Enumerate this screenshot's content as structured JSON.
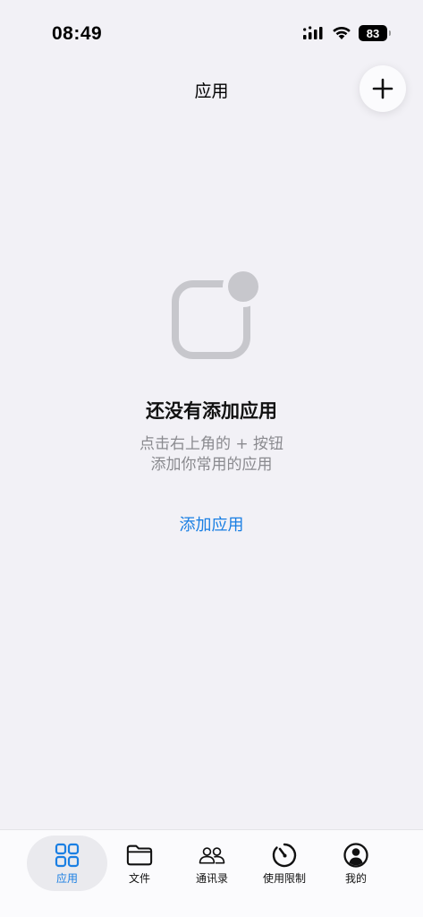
{
  "status_bar": {
    "time": "08:49",
    "battery": "83"
  },
  "header": {
    "title": "应用",
    "add_button_icon": "plus-icon"
  },
  "empty_state": {
    "illustration_icon": "app-badge-icon",
    "title": "还没有添加应用",
    "hint_line1": "点击右上角的 + 按钮",
    "hint_line2": "添加你常用的应用",
    "action_label": "添加应用"
  },
  "tab_bar": {
    "items": [
      {
        "label": "应用",
        "icon": "grid-icon",
        "active": true
      },
      {
        "label": "文件",
        "icon": "folder-icon",
        "active": false
      },
      {
        "label": "通讯录",
        "icon": "contacts-icon",
        "active": false
      },
      {
        "label": "使用限制",
        "icon": "timer-icon",
        "active": false
      },
      {
        "label": "我的",
        "icon": "profile-icon",
        "active": false
      }
    ]
  },
  "colors": {
    "background": "#F2F1F6",
    "accent": "#1A7FE3",
    "secondary_text": "#8A8A8F",
    "illustration": "#C7C7CC"
  }
}
